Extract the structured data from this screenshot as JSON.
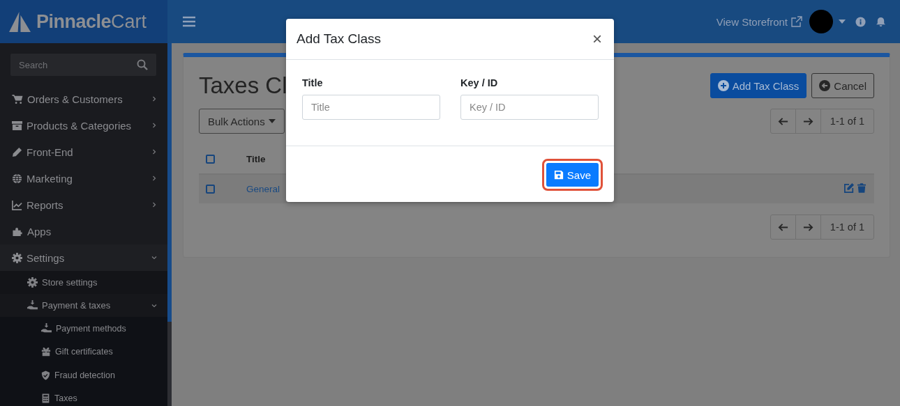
{
  "header": {
    "brand_bold": "Pinnacle",
    "brand_light": "Cart",
    "storefront_link": "View Storefront"
  },
  "sidebar": {
    "search": {
      "placeholder": "Search"
    },
    "items": [
      {
        "label": "Orders & Customers",
        "expanded": false
      },
      {
        "label": "Products & Categories",
        "expanded": false
      },
      {
        "label": "Front-End",
        "expanded": false
      },
      {
        "label": "Marketing",
        "expanded": false
      },
      {
        "label": "Reports",
        "expanded": false
      },
      {
        "label": "Apps"
      },
      {
        "label": "Settings",
        "expanded": true,
        "children": [
          {
            "label": "Store settings"
          },
          {
            "label": "Payment & taxes",
            "expanded": true,
            "children": [
              {
                "label": "Payment methods"
              },
              {
                "label": "Gift certificates"
              },
              {
                "label": "Fraud detection"
              },
              {
                "label": "Taxes"
              }
            ]
          }
        ]
      }
    ]
  },
  "page": {
    "title": "Taxes Cl",
    "buttons": [
      {
        "label": "Add Tax Class",
        "kind": "primary"
      },
      {
        "label": "Cancel",
        "kind": "outline"
      }
    ],
    "bulk_actions": "Bulk Actions",
    "pagination_top": "1-1 of 1",
    "pagination_bottom": "1-1 of 1",
    "table": {
      "columns": [
        "Title"
      ],
      "rows": [
        {
          "title": "General",
          "checked": false
        }
      ],
      "header_checked": false
    }
  },
  "modal": {
    "title": "Add Tax Class",
    "close": "×",
    "fields": [
      {
        "label": "Title",
        "placeholder": "Title"
      },
      {
        "label": "Key / ID",
        "placeholder": "Key / ID"
      }
    ],
    "save_button": {
      "label": "Save",
      "highlighted": true
    }
  }
}
